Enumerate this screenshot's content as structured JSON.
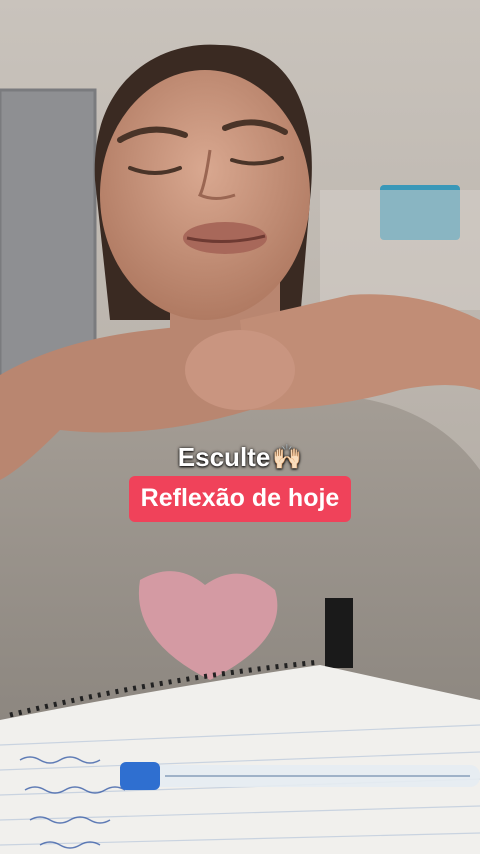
{
  "overlay": {
    "line1": "Esculte",
    "line1_emoji": "🙌🏻",
    "line2": "Reflexão de hoje",
    "highlight_color": "#f0425a"
  },
  "scene": {
    "description_icons": [
      "person-figure",
      "notebook",
      "pen"
    ]
  }
}
